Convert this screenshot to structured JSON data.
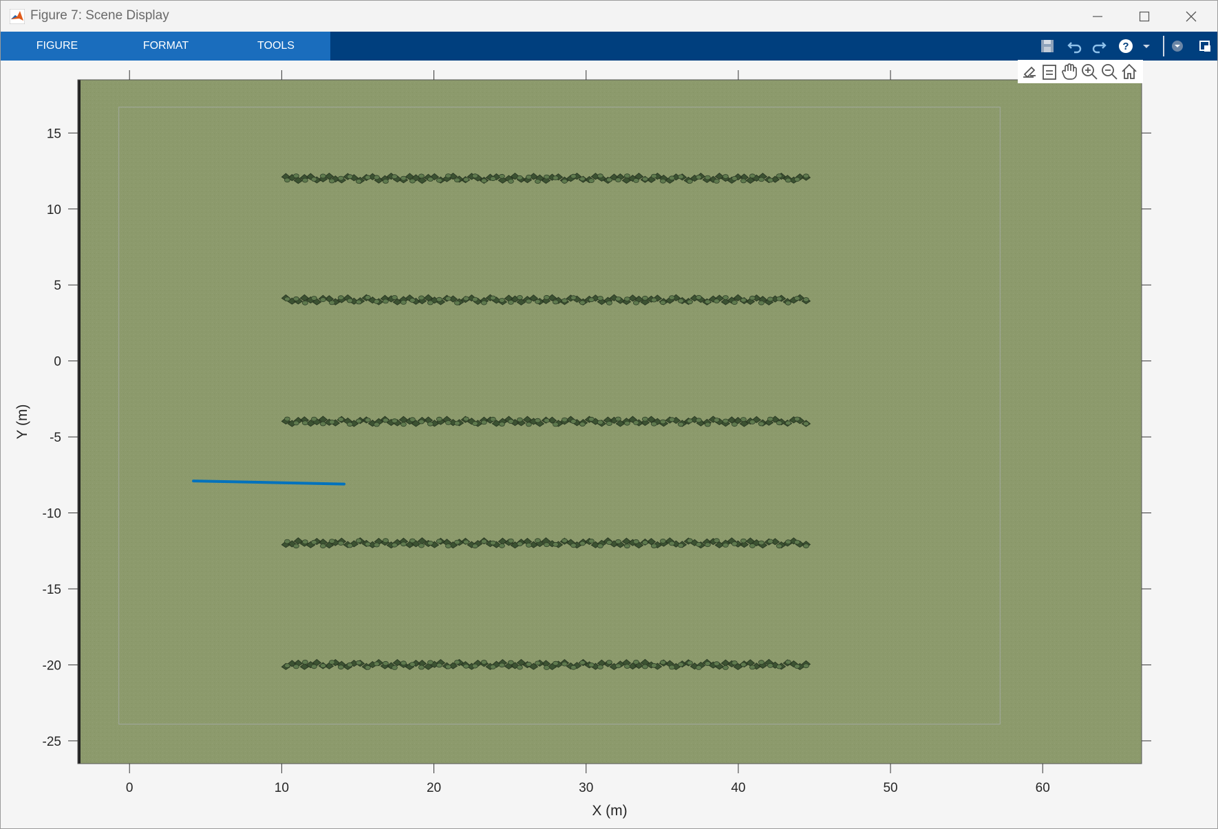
{
  "window": {
    "title": "Figure 7: Scene Display",
    "app_icon": "matlab-logo-icon",
    "controls": [
      "minimize-icon",
      "maximize-icon",
      "close-icon"
    ]
  },
  "toolstrip": {
    "tabs": [
      {
        "label": "FIGURE"
      },
      {
        "label": "FORMAT"
      },
      {
        "label": "TOOLS"
      }
    ],
    "quick_access": [
      "save-icon",
      "undo-icon",
      "redo-icon",
      "help-icon",
      "help-dropdown-icon",
      "collapse-toolstrip-icon",
      "undock-icon"
    ],
    "tab_color": "#1a6dbd",
    "bar_color": "#003f7e"
  },
  "axes_toolbar": [
    "brush-icon",
    "data-tips-icon",
    "pan-icon",
    "zoom-in-icon",
    "zoom-out-icon",
    "home-icon"
  ],
  "chart_data": {
    "type": "scene",
    "xlabel": "X (m)",
    "ylabel": "Y (m)",
    "xlim": [
      -3.4,
      66.5
    ],
    "ylim": [
      -26.5,
      18.5
    ],
    "xticks": [
      0,
      10,
      20,
      30,
      40,
      50,
      60
    ],
    "yticks": [
      15,
      10,
      5,
      0,
      -5,
      -10,
      -15,
      -20,
      -25
    ],
    "ground_color": "#8c9a6c",
    "boundary": {
      "x": [
        -0.7,
        57.2
      ],
      "y": [
        -23.9,
        16.7
      ]
    },
    "plant_rows": [
      {
        "y": 12,
        "x_start": 10,
        "x_end": 44.3
      },
      {
        "y": 4,
        "x_start": 10,
        "x_end": 44.3
      },
      {
        "y": -4,
        "x_start": 10,
        "x_end": 44.3
      },
      {
        "y": -12,
        "x_start": 10,
        "x_end": 44.3
      },
      {
        "y": -20,
        "x_start": 10,
        "x_end": 44.3
      }
    ],
    "path": {
      "color": "#0072bd",
      "x": [
        4.2,
        14.1
      ],
      "y": [
        -7.9,
        -8.1
      ]
    }
  }
}
